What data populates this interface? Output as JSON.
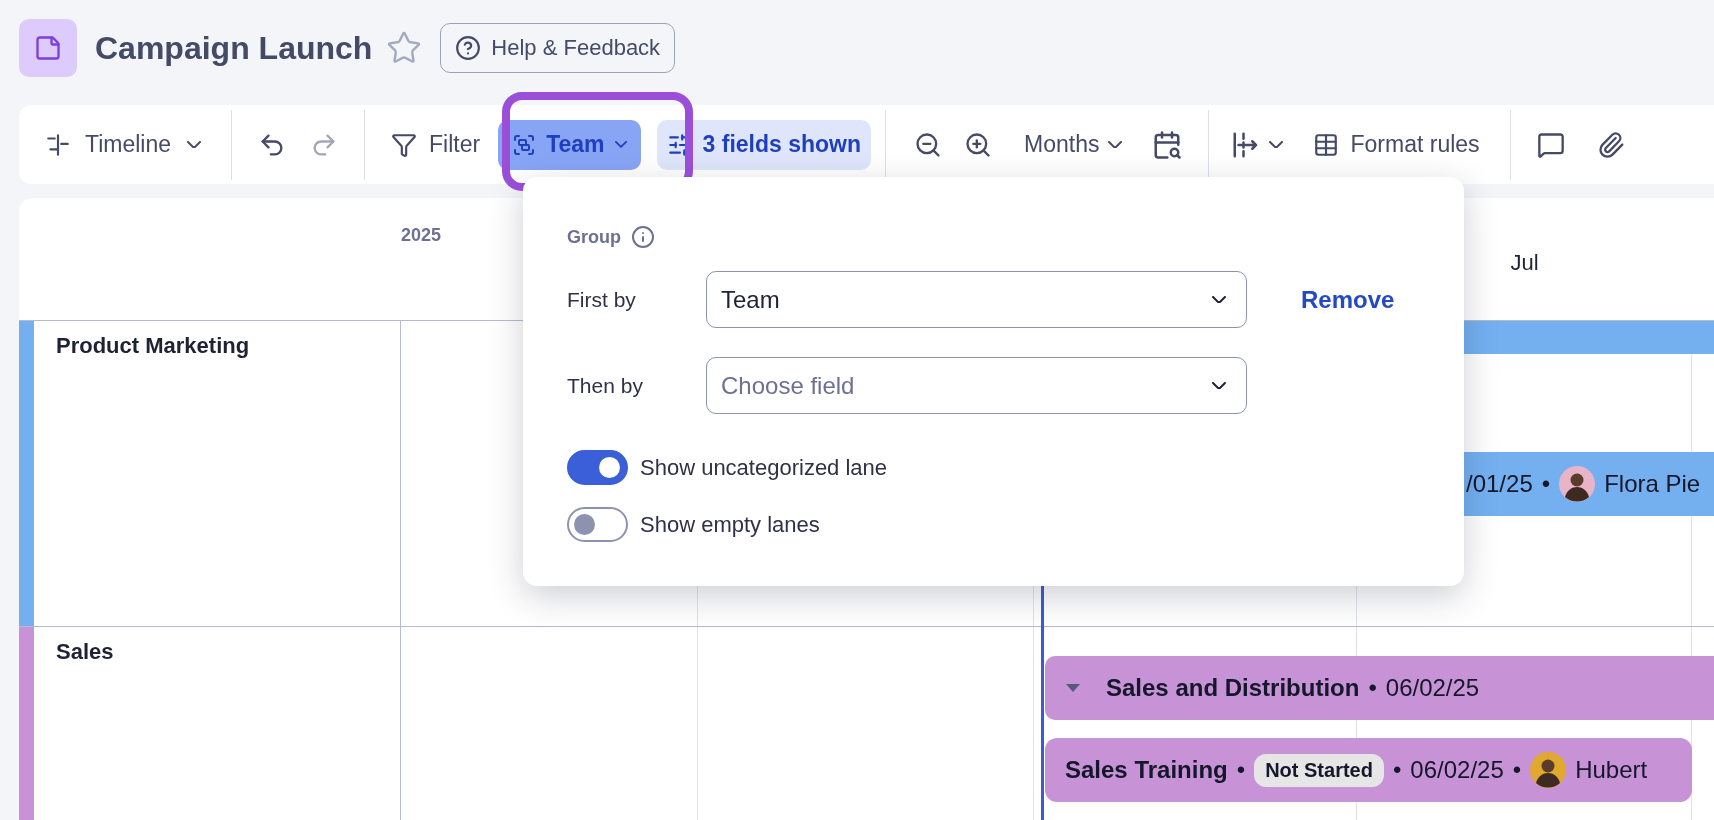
{
  "header": {
    "title": "Campaign Launch",
    "starred": false,
    "help_button": "Help & Feedback"
  },
  "toolbar": {
    "view": "Timeline",
    "filter": "Filter",
    "group_button": {
      "label": "Team",
      "selected": true,
      "highlighted": true
    },
    "fields_button": "3 fields shown",
    "scale": "Months",
    "format_rules": "Format rules"
  },
  "timeline": {
    "year": "2025",
    "months": [
      {
        "label": "Jul"
      }
    ],
    "lanes": [
      {
        "name": "Product Marketing",
        "color": "#74b0f0",
        "bars": [
          {
            "kind": "strip"
          },
          {
            "kind": "task",
            "parts": [
              {
                "kind": "date",
                "text": "/01/25"
              },
              {
                "kind": "sep",
                "text": "•"
              },
              {
                "kind": "avatar"
              },
              {
                "kind": "name",
                "text": "Flora Pie"
              }
            ]
          }
        ]
      },
      {
        "name": "Sales",
        "color": "#c792d6",
        "bars": [
          {
            "kind": "group",
            "parts": [
              {
                "kind": "caret"
              },
              {
                "kind": "title",
                "text": "Sales and Distribution"
              },
              {
                "kind": "sep",
                "text": "•"
              },
              {
                "kind": "date",
                "text": "06/02/25"
              }
            ]
          },
          {
            "kind": "task",
            "parts": [
              {
                "kind": "title",
                "text": "Sales Training"
              },
              {
                "kind": "sep",
                "text": "•"
              },
              {
                "kind": "status",
                "text": "Not Started"
              },
              {
                "kind": "sep",
                "text": "•"
              },
              {
                "kind": "date",
                "text": "06/02/25"
              },
              {
                "kind": "sep",
                "text": "•"
              },
              {
                "kind": "avatar2"
              },
              {
                "kind": "name",
                "text": "Hubert"
              }
            ]
          }
        ]
      }
    ]
  },
  "group_popover": {
    "open": true,
    "heading": "Group",
    "rows": [
      {
        "label": "First by",
        "value": "Team",
        "action": "Remove"
      },
      {
        "label": "Then by",
        "placeholder": "Choose field"
      }
    ],
    "toggles": [
      {
        "label": "Show uncategorized lane",
        "on": true
      },
      {
        "label": "Show empty lanes",
        "on": false
      }
    ]
  }
}
